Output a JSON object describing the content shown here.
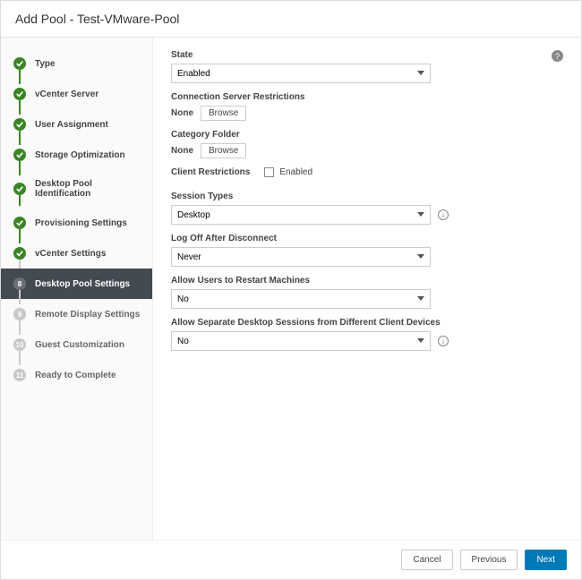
{
  "header": {
    "title": "Add Pool - Test-VMware-Pool"
  },
  "sidebar": {
    "steps": [
      {
        "label": "Type",
        "state": "done"
      },
      {
        "label": "vCenter Server",
        "state": "done"
      },
      {
        "label": "User Assignment",
        "state": "done"
      },
      {
        "label": "Storage Optimization",
        "state": "done"
      },
      {
        "label": "Desktop Pool Identification",
        "state": "done"
      },
      {
        "label": "Provisioning Settings",
        "state": "done"
      },
      {
        "label": "vCenter Settings",
        "state": "done"
      },
      {
        "label": "Desktop Pool Settings",
        "state": "active",
        "num": "8"
      },
      {
        "label": "Remote Display Settings",
        "state": "pending",
        "num": "9"
      },
      {
        "label": "Guest Customization",
        "state": "pending",
        "num": "10"
      },
      {
        "label": "Ready to Complete",
        "state": "pending",
        "num": "11"
      }
    ]
  },
  "form": {
    "state": {
      "label": "State",
      "value": "Enabled"
    },
    "connRestrict": {
      "label": "Connection Server Restrictions",
      "value": "None",
      "browse": "Browse"
    },
    "categoryFolder": {
      "label": "Category Folder",
      "value": "None",
      "browse": "Browse"
    },
    "clientRestrict": {
      "label": "Client Restrictions",
      "checkboxLabel": "Enabled"
    },
    "sessionTypes": {
      "label": "Session Types",
      "value": "Desktop"
    },
    "logOff": {
      "label": "Log Off After Disconnect",
      "value": "Never"
    },
    "allowRestart": {
      "label": "Allow Users to Restart Machines",
      "value": "No"
    },
    "allowSeparate": {
      "label": "Allow Separate Desktop Sessions from Different Client Devices",
      "value": "No"
    }
  },
  "footer": {
    "cancel": "Cancel",
    "previous": "Previous",
    "next": "Next"
  },
  "help": "?"
}
